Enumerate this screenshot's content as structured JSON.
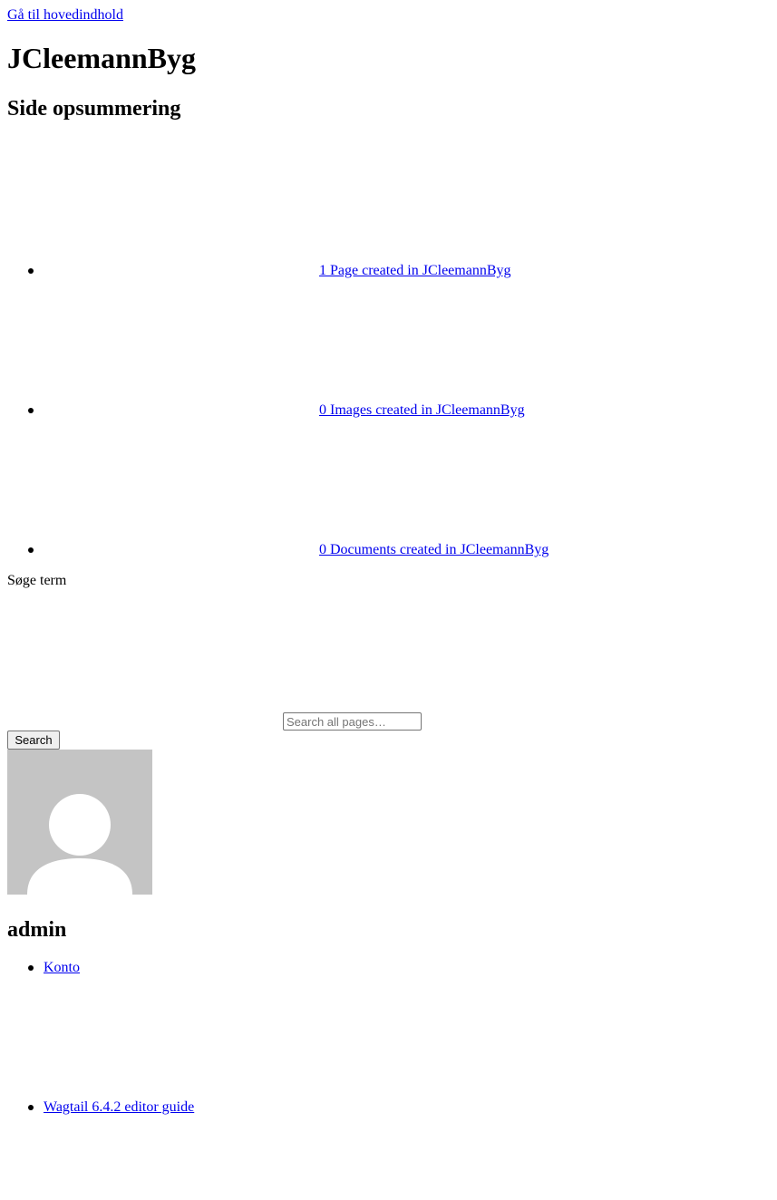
{
  "skip_link": "Gå til hovedindhold",
  "site_title": "JCleemannByg",
  "summary": {
    "heading": "Side opsummering",
    "items": [
      {
        "label": "1 Page created in JCleemannByg"
      },
      {
        "label": "0 Images created in JCleemannByg"
      },
      {
        "label": "0 Documents created in JCleemannByg"
      }
    ]
  },
  "search": {
    "label": "Søge term",
    "placeholder": "Search all pages…",
    "button_label": "Search"
  },
  "user": {
    "avatar_icon": "default-user-avatar-icon",
    "name": "admin",
    "menu": [
      {
        "label": "Konto"
      },
      {
        "label": "Wagtail 6.4.2 editor guide"
      }
    ]
  },
  "colors": {
    "link": "#0000ee",
    "avatar_bg": "#c4c4c4",
    "avatar_figure": "#ffffff"
  }
}
